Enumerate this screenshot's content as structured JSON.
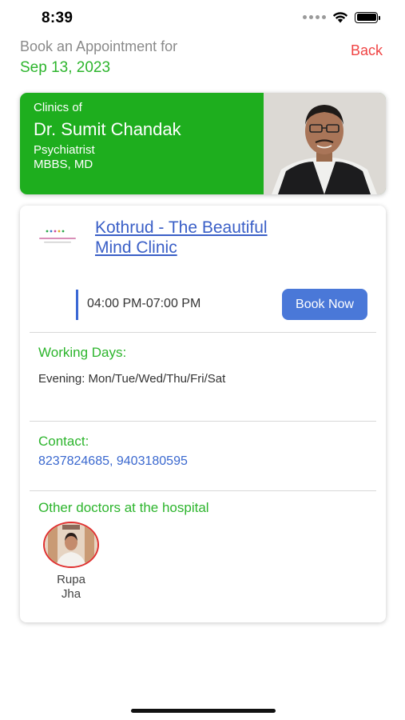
{
  "status": {
    "time": "8:39"
  },
  "header": {
    "label": "Book an Appointment for",
    "date": "Sep 13, 2023",
    "back_label": "Back"
  },
  "doctor": {
    "clinics_of": "Clinics of",
    "name": "Dr. Sumit Chandak",
    "specialty": "Psychiatrist",
    "degree": "MBBS, MD"
  },
  "clinic": {
    "name_line1": "Kothrud - The Beautiful",
    "name_line2": "Mind Clinic",
    "timing": "04:00 PM-07:00 PM",
    "book_label": "Book Now",
    "working_days_label": "Working Days:",
    "working_days_value": "Evening: Mon/Tue/Wed/Thu/Fri/Sat",
    "contact_label": "Contact:",
    "contact_value": "8237824685, 9403180595",
    "other_doctors_label": "Other doctors at the hospital",
    "other_doctors": [
      {
        "first": "Rupa",
        "last": "Jha"
      }
    ]
  },
  "colors": {
    "accent_green": "#2db52d",
    "card_green": "#1eae1e",
    "back_red": "#f04444",
    "link_blue": "#3a5fc7",
    "button_blue": "#4a78d8"
  }
}
